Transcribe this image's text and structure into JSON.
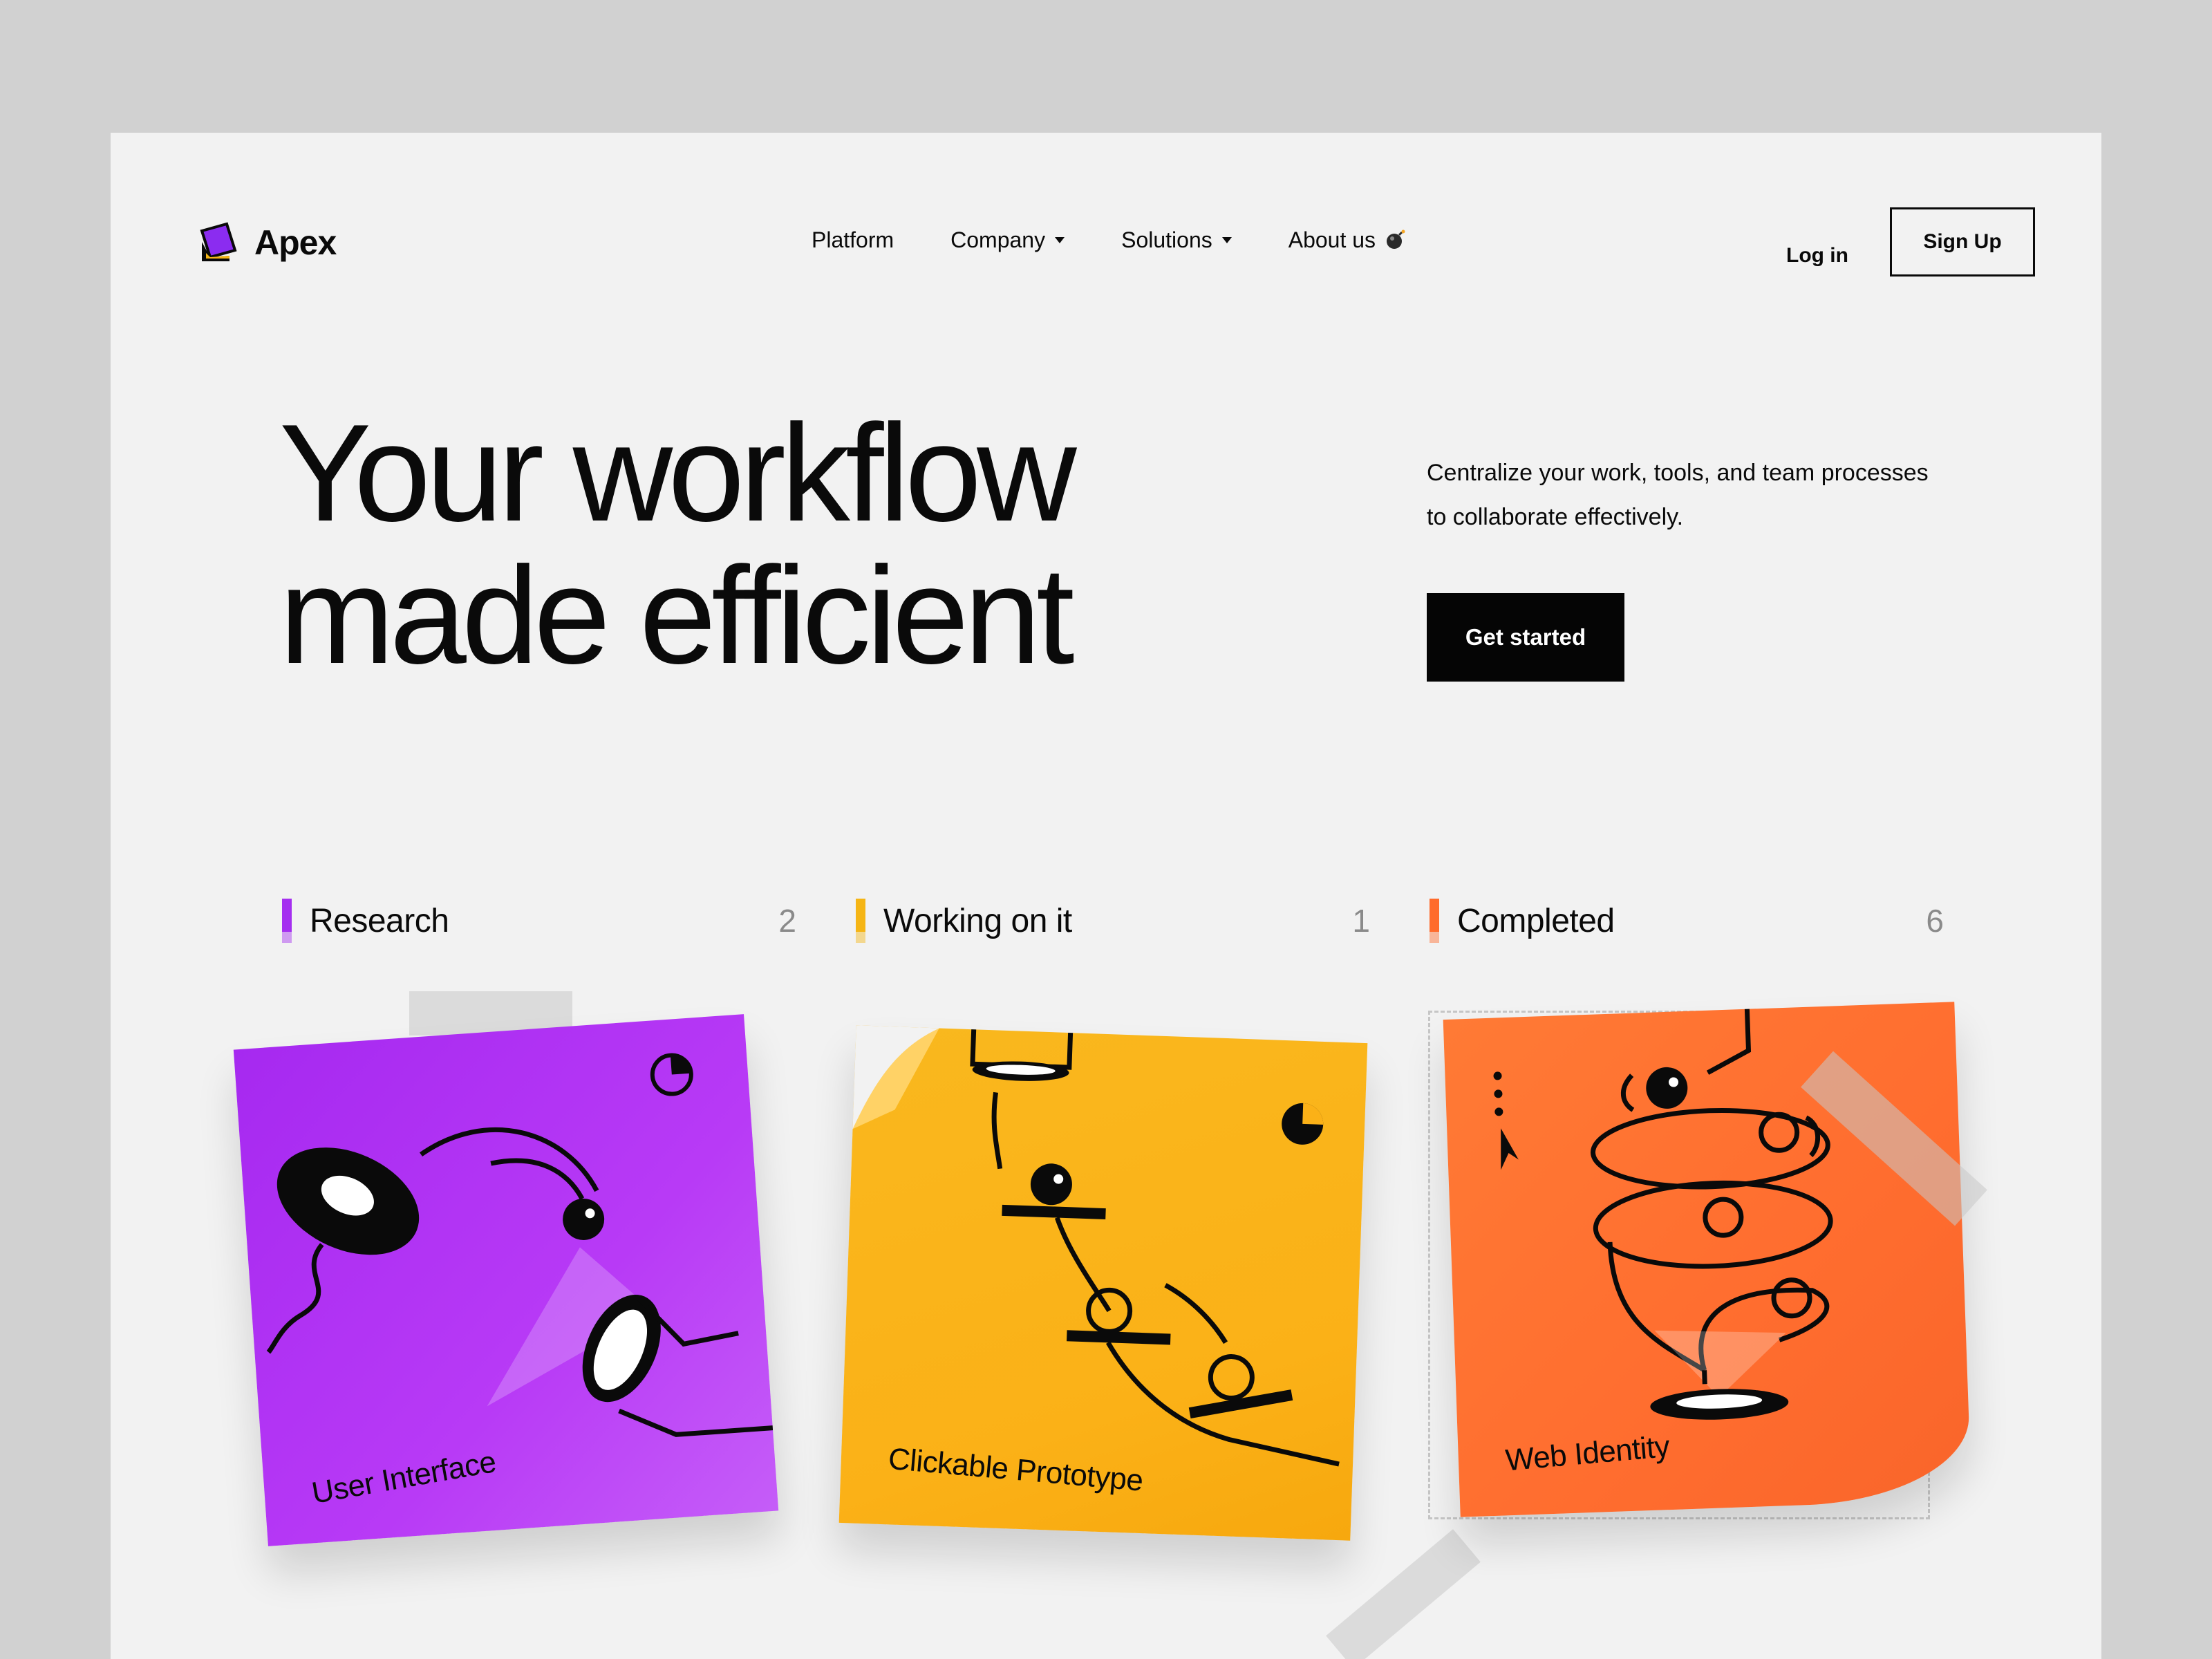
{
  "brand": {
    "name": "Apex"
  },
  "nav": {
    "items": [
      {
        "label": "Platform",
        "has_caret": false
      },
      {
        "label": "Company",
        "has_caret": true
      },
      {
        "label": "Solutions",
        "has_caret": true
      },
      {
        "label": "About us",
        "has_caret": false,
        "icon": "bomb-icon"
      }
    ],
    "login_label": "Log in",
    "signup_label": "Sign Up"
  },
  "hero": {
    "title_lines": [
      "Your workflow",
      "made efficient"
    ],
    "subtitle_lines": [
      "Centralize your work, tools, and team processes",
      "to collaborate effectively."
    ],
    "cta_label": "Get started"
  },
  "board": {
    "columns": [
      {
        "title": "Research",
        "count": "2",
        "color": "#a52ff0",
        "card": {
          "label": "User Interface",
          "color": "#b434f2"
        }
      },
      {
        "title": "Working on it",
        "count": "1",
        "color": "#f5b515",
        "card": {
          "label": "Clickable Prototype",
          "color": "#fbb117"
        }
      },
      {
        "title": "Completed",
        "count": "6",
        "color": "#ff6b2c",
        "card": {
          "label": "Web Identity",
          "color": "#ff6d2f"
        }
      }
    ]
  },
  "colors": {
    "background": "#f2f2f2",
    "outer": "#d1d1d1",
    "ink": "#0a0a0a"
  }
}
